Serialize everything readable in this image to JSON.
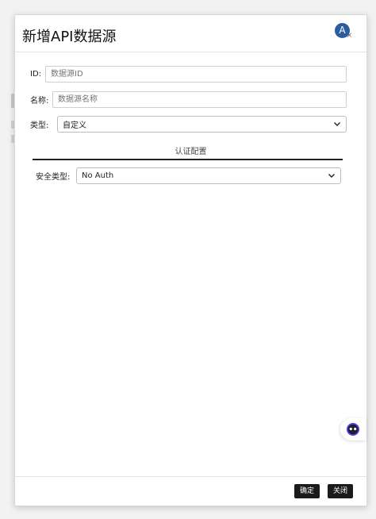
{
  "dialog": {
    "title": "新增API数据源",
    "avatar_letter": "A",
    "close_glyph": "×"
  },
  "form": {
    "id_label": "ID:",
    "id_placeholder": "数据源ID",
    "name_label": "名称:",
    "name_placeholder": "数据源名称",
    "type_label": "类型:",
    "type_value": "自定义",
    "auth_section_title": "认证配置",
    "security_label": "安全类型:",
    "security_value": "No Auth"
  },
  "footer": {
    "confirm_label": "确定",
    "close_label": "关闭"
  },
  "icons": {
    "avatar": "avatar-icon",
    "chevron": "chevron-down-icon",
    "assistant": "assistant-bot-icon"
  },
  "colors": {
    "avatar_bg": "#2a5d9f",
    "button_bg": "#1b1b1b",
    "bot_accent": "#4a3cff"
  }
}
